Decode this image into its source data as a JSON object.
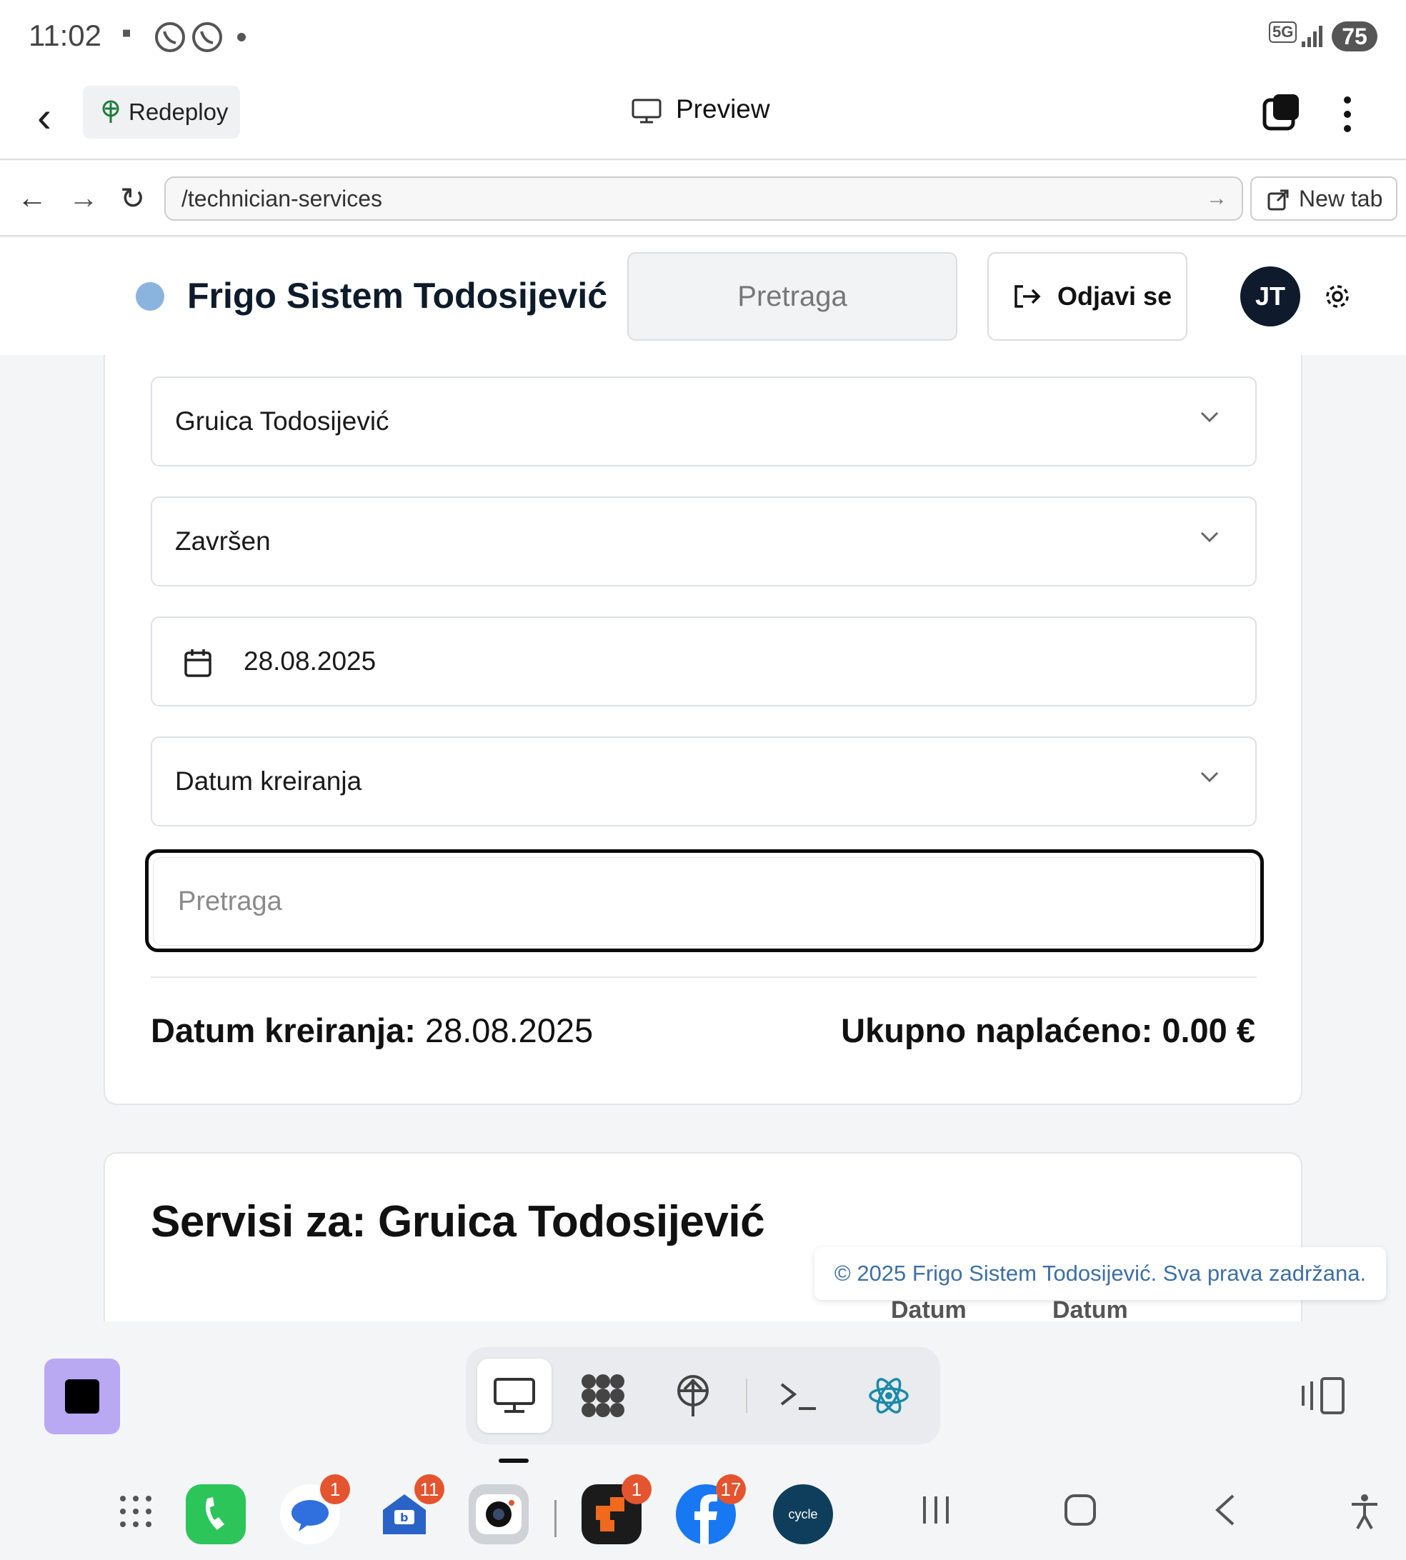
{
  "status_bar": {
    "time": "11:02",
    "battery": "75",
    "network": "5G"
  },
  "app_header": {
    "redeploy_label": "Redeploy",
    "preview_label": "Preview"
  },
  "browser": {
    "url": "/technician-services",
    "new_tab_label": "New tab"
  },
  "page_header": {
    "brand": "Frigo Sistem Todosijević",
    "search_label": "Pretraga",
    "logout_label": "Odjavi se",
    "avatar_initials": "JT"
  },
  "filters": {
    "technician": "Gruica Todosijević",
    "status": "Završen",
    "date": "28.08.2025",
    "sort": "Datum kreiranja",
    "search_placeholder": "Pretraga"
  },
  "summary": {
    "date_label": "Datum kreiranja:",
    "date_value": "28.08.2025",
    "total_label": "Ukupno naplaćeno:",
    "total_value": "0.00 €"
  },
  "services": {
    "title": "Servisi za: Gruica Todosijević",
    "col_1": "Datum",
    "col_2": "Datum"
  },
  "footer": {
    "copyright": "© 2025 Frigo Sistem Todosijević. Sva prava zadržana."
  },
  "dock": {
    "tools": [
      "monitor-icon",
      "apps-grid-icon",
      "deploy-icon",
      "terminal-icon",
      "react-icon"
    ]
  },
  "taskbar": {
    "apps": [
      {
        "name": "phone",
        "badge": ""
      },
      {
        "name": "messages",
        "badge": "1"
      },
      {
        "name": "mail",
        "badge": "11"
      },
      {
        "name": "camera",
        "badge": ""
      },
      {
        "name": "app-orange",
        "badge": "1"
      },
      {
        "name": "facebook",
        "badge": "17"
      },
      {
        "name": "cycle",
        "badge": ""
      }
    ],
    "cycle_label": "cycle"
  },
  "colors": {
    "brand_navy": "#0f1a2c",
    "stop_purple": "#b9a8f2",
    "footer_link": "#3e6fa3"
  }
}
